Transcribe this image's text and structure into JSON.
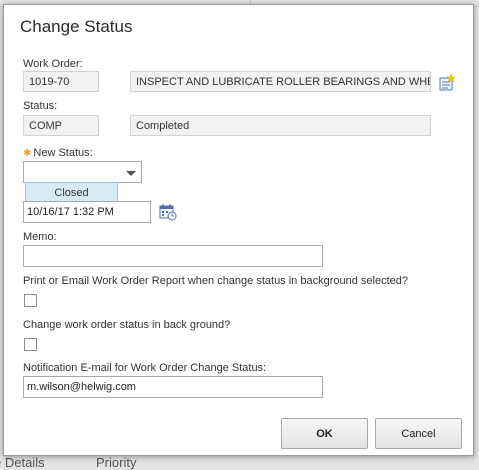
{
  "background": {
    "bottom_left_text": "e Details",
    "bottom_mid_text": "Priority"
  },
  "dialog": {
    "title": "Change Status",
    "work_order": {
      "label": "Work Order:",
      "value": "1019-70",
      "description": "INSPECT AND LUBRICATE ROLLER BEARINGS AND WHE",
      "detail_icon": "detail-menu-icon"
    },
    "status": {
      "label": "Status:",
      "code": "COMP",
      "description": "Completed"
    },
    "new_status": {
      "label": "New Status:",
      "required": true,
      "value": "",
      "dropdown_options": [
        "Closed"
      ]
    },
    "date": {
      "value": "10/16/17 1:32 PM",
      "calendar_icon": "calendar-icon"
    },
    "memo": {
      "label": "Memo:",
      "value": ""
    },
    "print_email_option": {
      "label": "Print or Email Work Order Report when change status in background selected?",
      "checked": false
    },
    "background_option": {
      "label": "Change work order status in back ground?",
      "checked": false
    },
    "notification_email": {
      "label": "Notification E-mail for Work Order Change Status:",
      "value": "m.wilson@helwig.com"
    },
    "buttons": {
      "ok": "OK",
      "cancel": "Cancel"
    }
  },
  "colors": {
    "required_star": "#f0a030",
    "dropdown_highlight": "#d7ebf7",
    "readonly_bg": "#f2f2f2"
  }
}
